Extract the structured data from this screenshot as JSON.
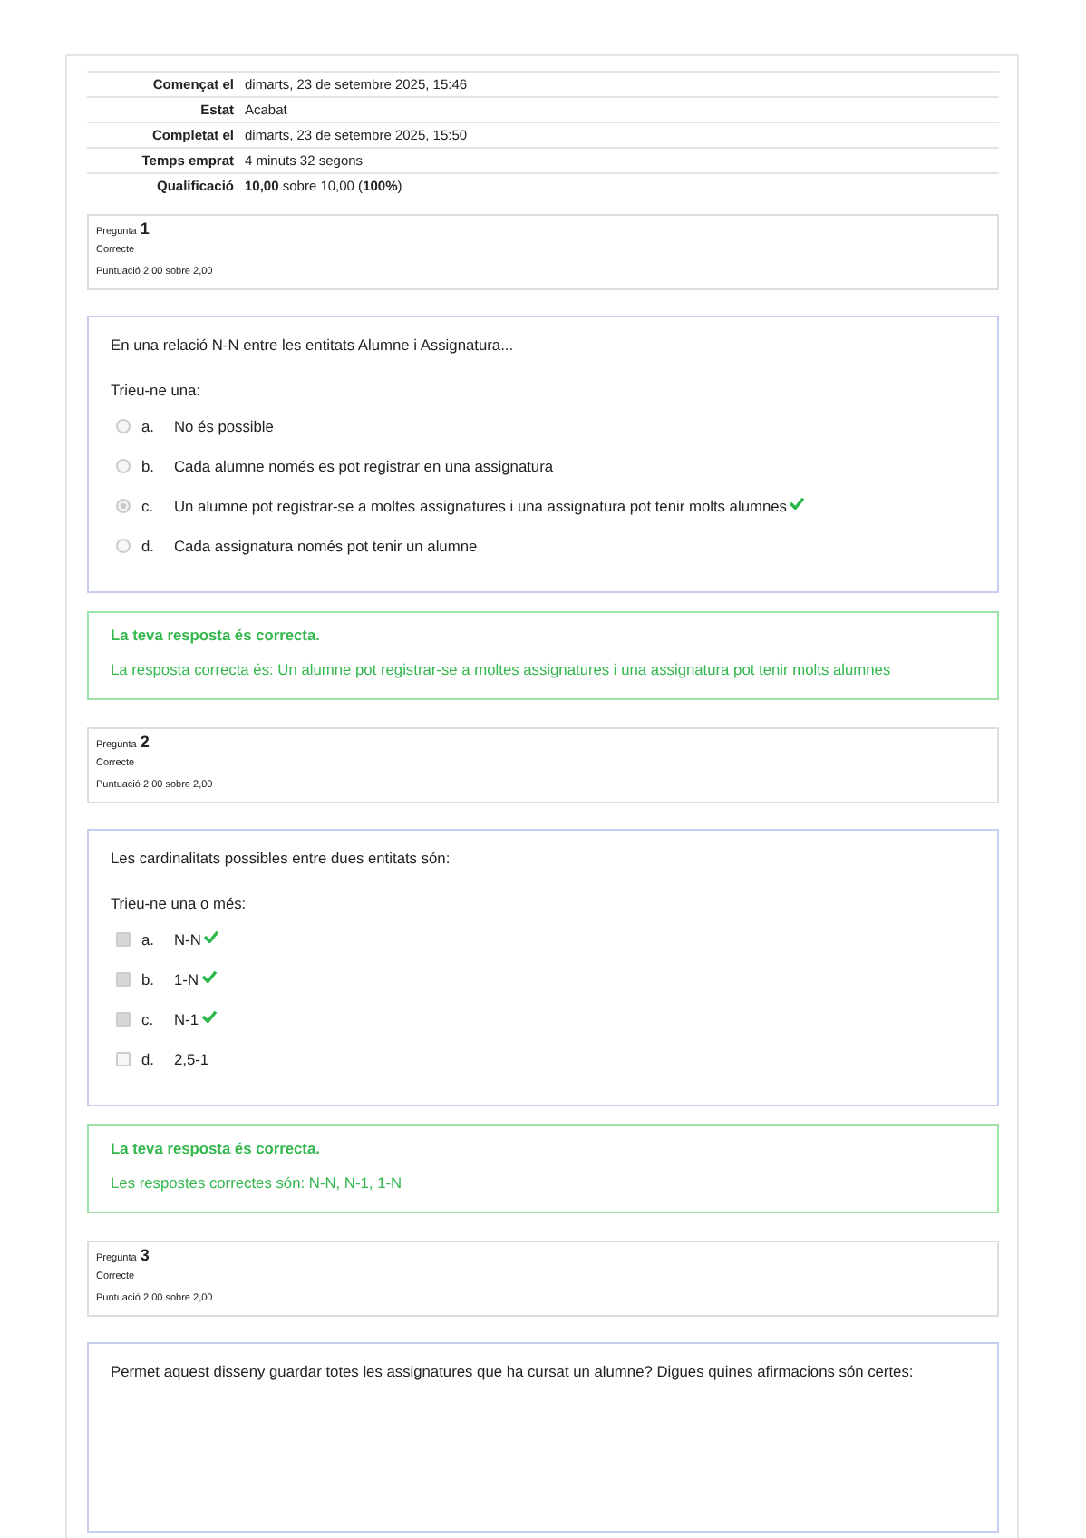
{
  "summary": [
    {
      "label": "Començat el",
      "value": "dimarts, 23 de setembre 2025, 15:46"
    },
    {
      "label": "Estat",
      "value": "Acabat"
    },
    {
      "label": "Completat el",
      "value": "dimarts, 23 de setembre 2025, 15:50"
    },
    {
      "label": "Temps emprat",
      "value": "4 minuts 32 segons"
    },
    {
      "label": "Qualificació",
      "value": "**10,00** sobre 10,00 (**100%**)"
    }
  ],
  "questions": [
    {
      "label": "Pregunta",
      "number": "1",
      "state": "Correcte",
      "mark": "Puntuació 2,00 sobre 2,00",
      "text": "En una relació N-N entre les entitats Alumne i Assignatura...",
      "prompt": "Trieu-ne una:",
      "kind": "radio",
      "options": [
        {
          "letter": "a.",
          "text": "No és possible",
          "selected": false,
          "correct": false
        },
        {
          "letter": "b.",
          "text": "Cada alumne només es pot registrar en una assignatura",
          "selected": false,
          "correct": false
        },
        {
          "letter": "c.",
          "text": "Un alumne pot registrar-se a moltes assignatures i una assignatura pot tenir molts alumnes",
          "selected": true,
          "correct": true
        },
        {
          "letter": "d.",
          "text": "Cada assignatura només pot tenir un alumne",
          "selected": false,
          "correct": false
        }
      ],
      "feedback": {
        "title": "La teva resposta és correcta.",
        "text": "La resposta correcta és: Un alumne pot registrar-se a moltes assignatures i una assignatura pot tenir molts alumnes"
      }
    },
    {
      "label": "Pregunta",
      "number": "2",
      "state": "Correcte",
      "mark": "Puntuació 2,00 sobre 2,00",
      "text": "Les cardinalitats possibles entre dues entitats són:",
      "prompt": "Trieu-ne una o més:",
      "kind": "checkbox",
      "options": [
        {
          "letter": "a.",
          "text": "N-N",
          "selected": true,
          "correct": true
        },
        {
          "letter": "b.",
          "text": "1-N",
          "selected": true,
          "correct": true
        },
        {
          "letter": "c.",
          "text": "N-1",
          "selected": true,
          "correct": true
        },
        {
          "letter": "d.",
          "text": "2,5-1",
          "selected": false,
          "correct": false
        }
      ],
      "feedback": {
        "title": "La teva resposta és correcta.",
        "text": "Les respostes correctes són: N-N, N-1, 1-N"
      }
    },
    {
      "label": "Pregunta",
      "number": "3",
      "state": "Correcte",
      "mark": "Puntuació 2,00 sobre 2,00",
      "text": "Permet aquest disseny guardar totes les assignatures que ha cursat un alumne? Digues quines afirmacions són certes:"
    }
  ]
}
